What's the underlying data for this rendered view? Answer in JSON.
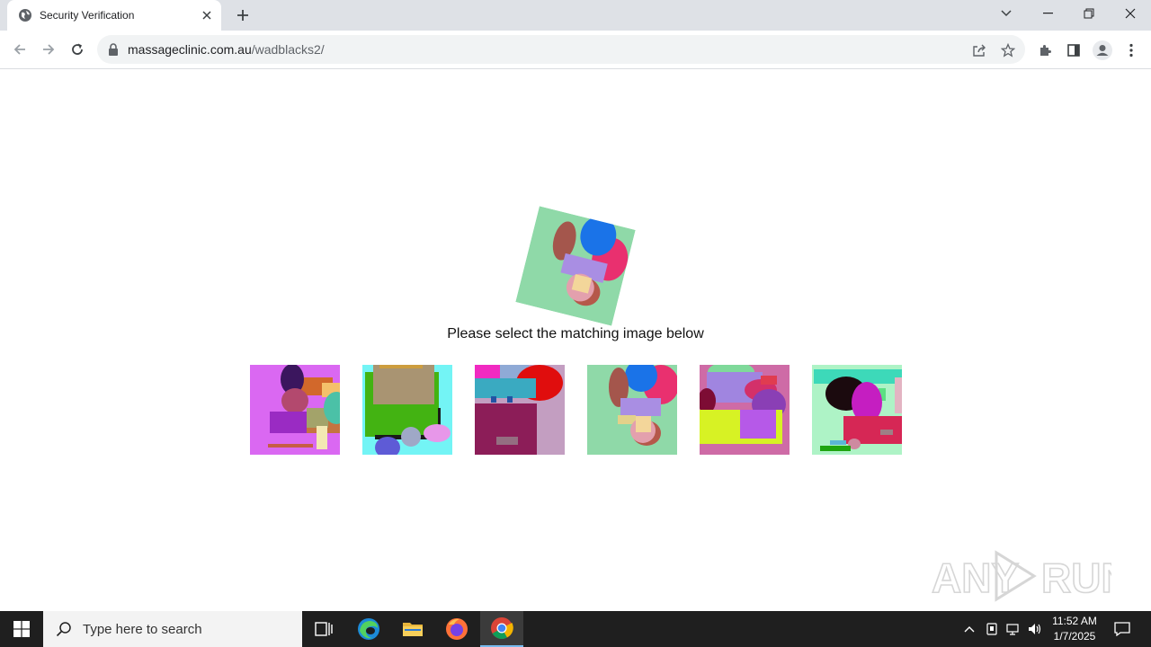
{
  "browser": {
    "tab_title": "Security Verification",
    "url_domain": "massageclinic.com.au",
    "url_path": "/wadblacks2/"
  },
  "page": {
    "prompt": "Please select the matching image below",
    "options_count_label": "",
    "watermark": "ANY RUN"
  },
  "taskbar": {
    "search_placeholder": "Type here to search",
    "time": "11:52 AM",
    "date": "1/7/2025"
  },
  "colors": {
    "tab_strip": "#dee1e6",
    "omnibox": "#f1f3f4",
    "taskbar": "#1f1f1f",
    "reference_bg": "#8fd9a8"
  },
  "icons": [
    "globe-icon",
    "close-icon",
    "plus-icon",
    "back-icon",
    "forward-icon",
    "reload-icon",
    "lock-icon",
    "share-icon",
    "star-icon",
    "extensions-icon",
    "sidepanel-icon",
    "profile-icon",
    "menu-icon",
    "windows-icon",
    "search-icon",
    "task-view-icon",
    "edge-icon",
    "folder-icon",
    "firefox-icon",
    "chrome-icon"
  ]
}
